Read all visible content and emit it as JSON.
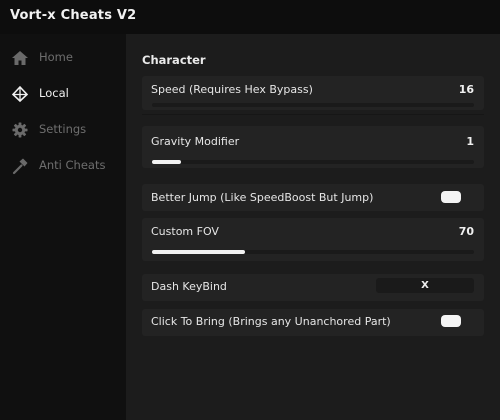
{
  "window": {
    "title": "Vort-x Cheats V2"
  },
  "sidebar": {
    "items": [
      {
        "label": "Home",
        "icon": "home-icon",
        "active": false
      },
      {
        "label": "Local",
        "icon": "diamond-icon",
        "active": true
      },
      {
        "label": "Settings",
        "icon": "gear-icon",
        "active": false
      },
      {
        "label": "Anti Cheats",
        "icon": "hammer-icon",
        "active": false
      }
    ]
  },
  "main": {
    "section_title": "Character",
    "speed": {
      "label": "Speed (Requires Hex Bypass)",
      "value": "16"
    },
    "gravity": {
      "label": "Gravity Modifier",
      "value": "1",
      "fill_fraction": 0.09
    },
    "better_jump": {
      "label": "Better Jump (Like SpeedBoost But Jump)",
      "enabled": true
    },
    "fov": {
      "label": "Custom FOV",
      "value": "70",
      "fill_fraction": 0.29
    },
    "dash": {
      "label": "Dash KeyBind",
      "key": "X"
    },
    "click_bring": {
      "label": "Click To Bring (Brings any Unanchored Part)",
      "enabled": true
    }
  },
  "colors": {
    "background": "#141414",
    "panel": "#1c1c1c",
    "row": "#232323",
    "accent": "#f2f2f2"
  }
}
